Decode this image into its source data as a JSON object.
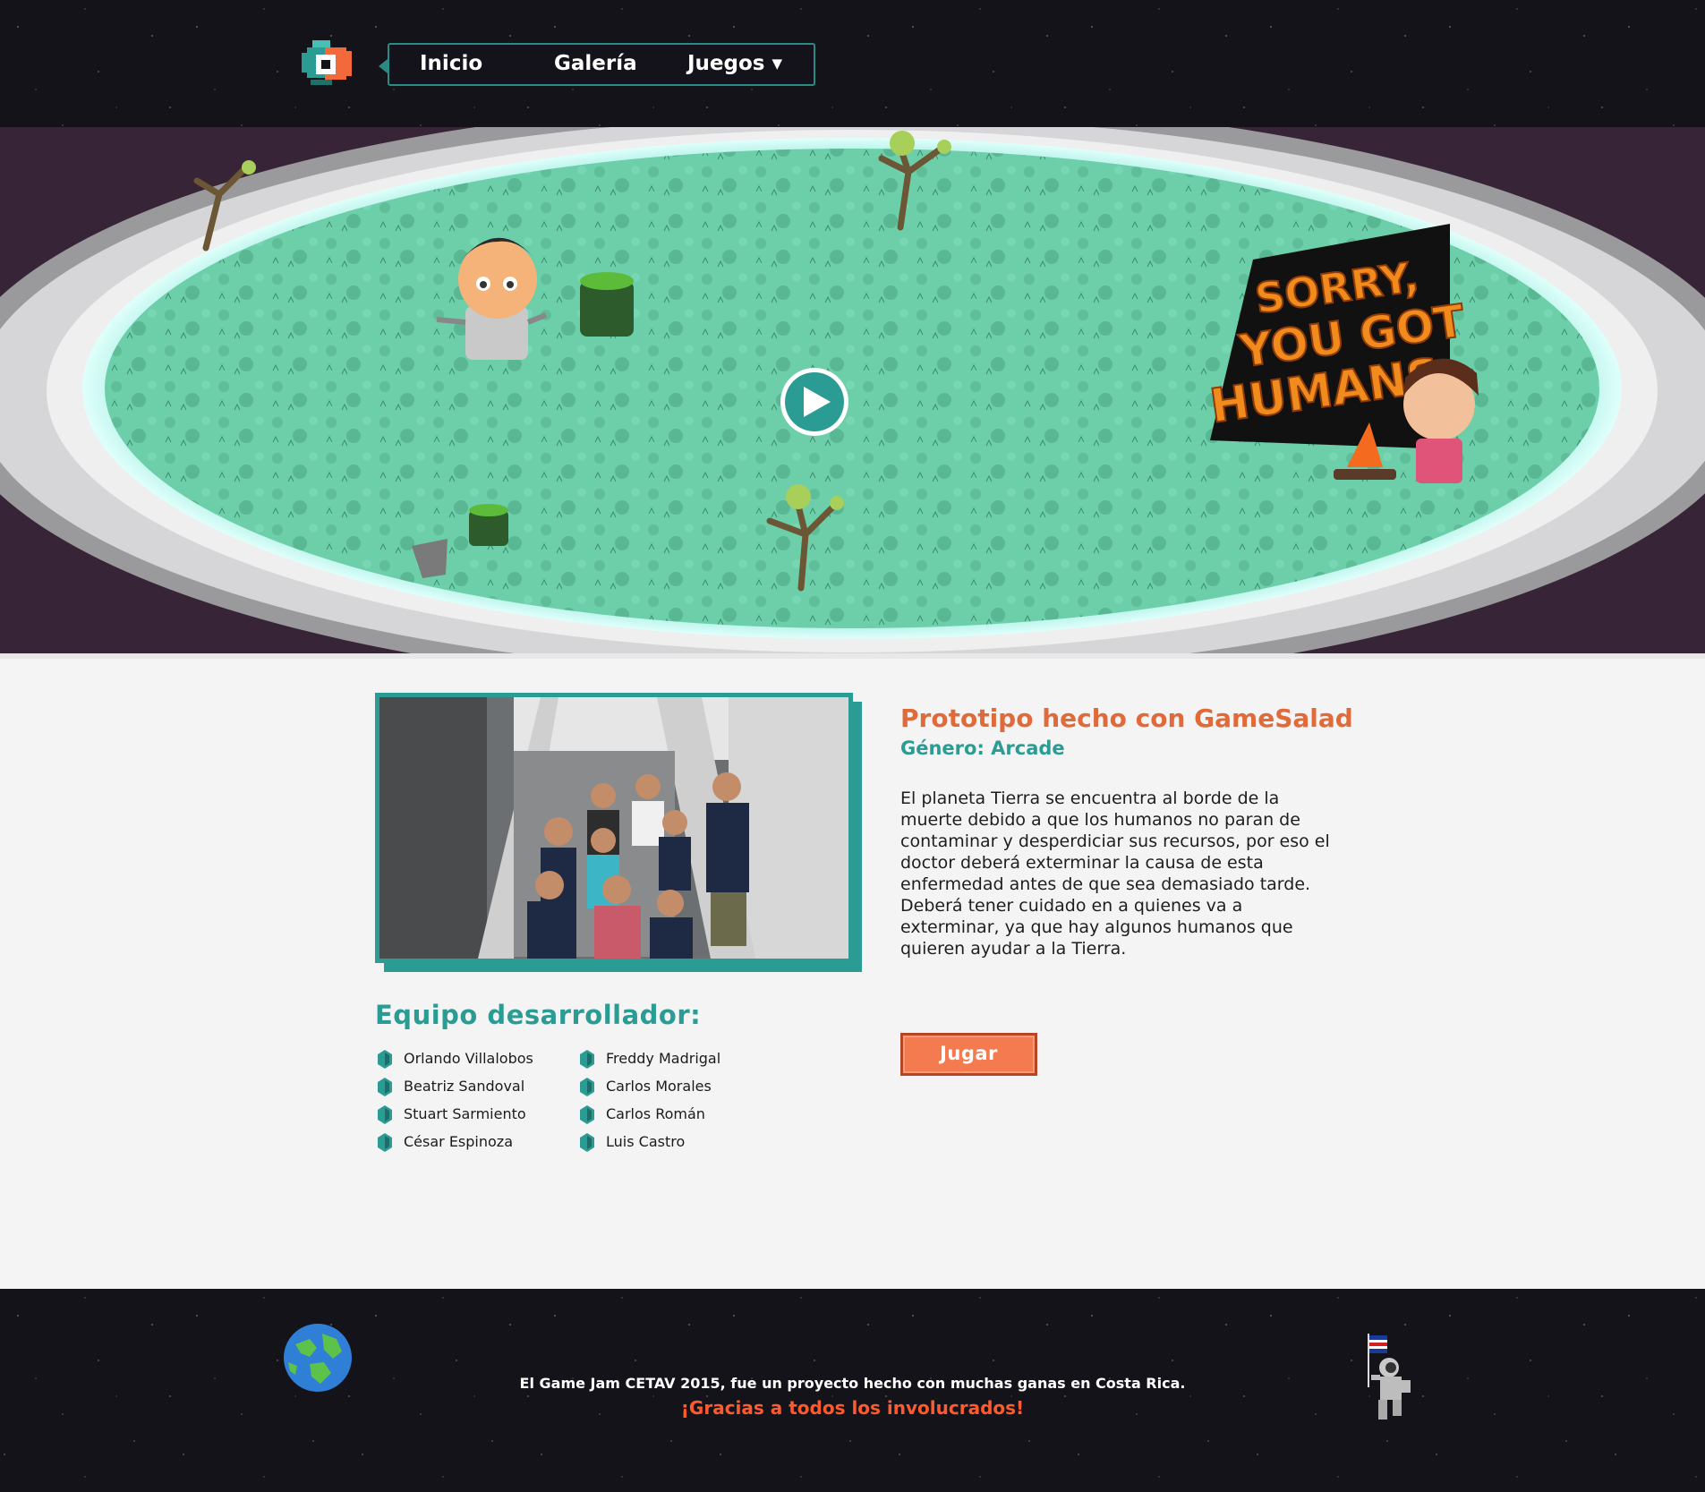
{
  "header": {
    "nav": {
      "inicio": "Inicio",
      "galeria": "Galería",
      "juegos": "Juegos"
    }
  },
  "hero": {
    "game_logo_text": [
      "SORRY,",
      "YOU GOT",
      "HUMANS"
    ]
  },
  "main": {
    "game_title": "Prototipo hecho con GameSalad",
    "genre": "Género: Arcade",
    "description": "El planeta Tierra se encuentra al borde de la muerte debido a que los humanos no paran de contaminar y desperdiciar sus recursos, por eso el doctor deberá exterminar la causa de esta enfermedad antes de que sea demasiado tarde. Deberá tener cuidado en a quienes va a exterminar, ya que hay algunos humanos que quieren ayudar a la Tierra.",
    "play_button": "Jugar",
    "team_title": "Equipo desarrollador:",
    "team_members": [
      "Orlando Villalobos",
      "Beatriz Sandoval",
      "Stuart Sarmiento",
      "César Espinoza",
      "Freddy Madrigal",
      "Carlos Morales",
      "Carlos Román",
      "Luis Castro"
    ]
  },
  "footer": {
    "text": "El Game Jam CETAV 2015, fue un proyecto hecho con muchas ganas en Costa Rica.",
    "thanks": "¡Gracias a todos los involucrados!"
  },
  "colors": {
    "accent_teal": "#2b9c94",
    "accent_orange": "#e06a3a",
    "button_orange": "#f47a4f",
    "footer_thanks": "#ff5a2e",
    "space_bg": "#15131a"
  },
  "icons": {
    "logo": "gamejam-logo-icon",
    "dropdown": "caret-down-icon",
    "video_play": "play-circle-icon",
    "member_bullet": "gem-icon",
    "footer_left": "earth-icon",
    "footer_right": "astronaut-icon"
  }
}
